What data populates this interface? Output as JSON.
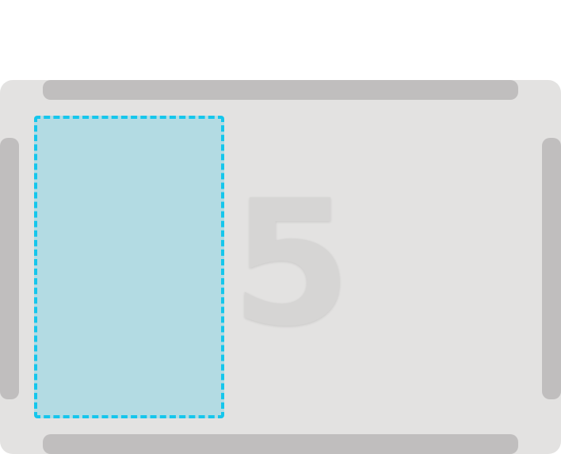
{
  "layout_preview": {
    "zone_number": "5",
    "colors": {
      "background": "#ffffff",
      "panel": "#e3e2e1",
      "edge_bars": "#c0bebe",
      "selection_fill": "#b3dbe3",
      "selection_border": "#15c6ec",
      "number": "#d6d5d4"
    }
  }
}
